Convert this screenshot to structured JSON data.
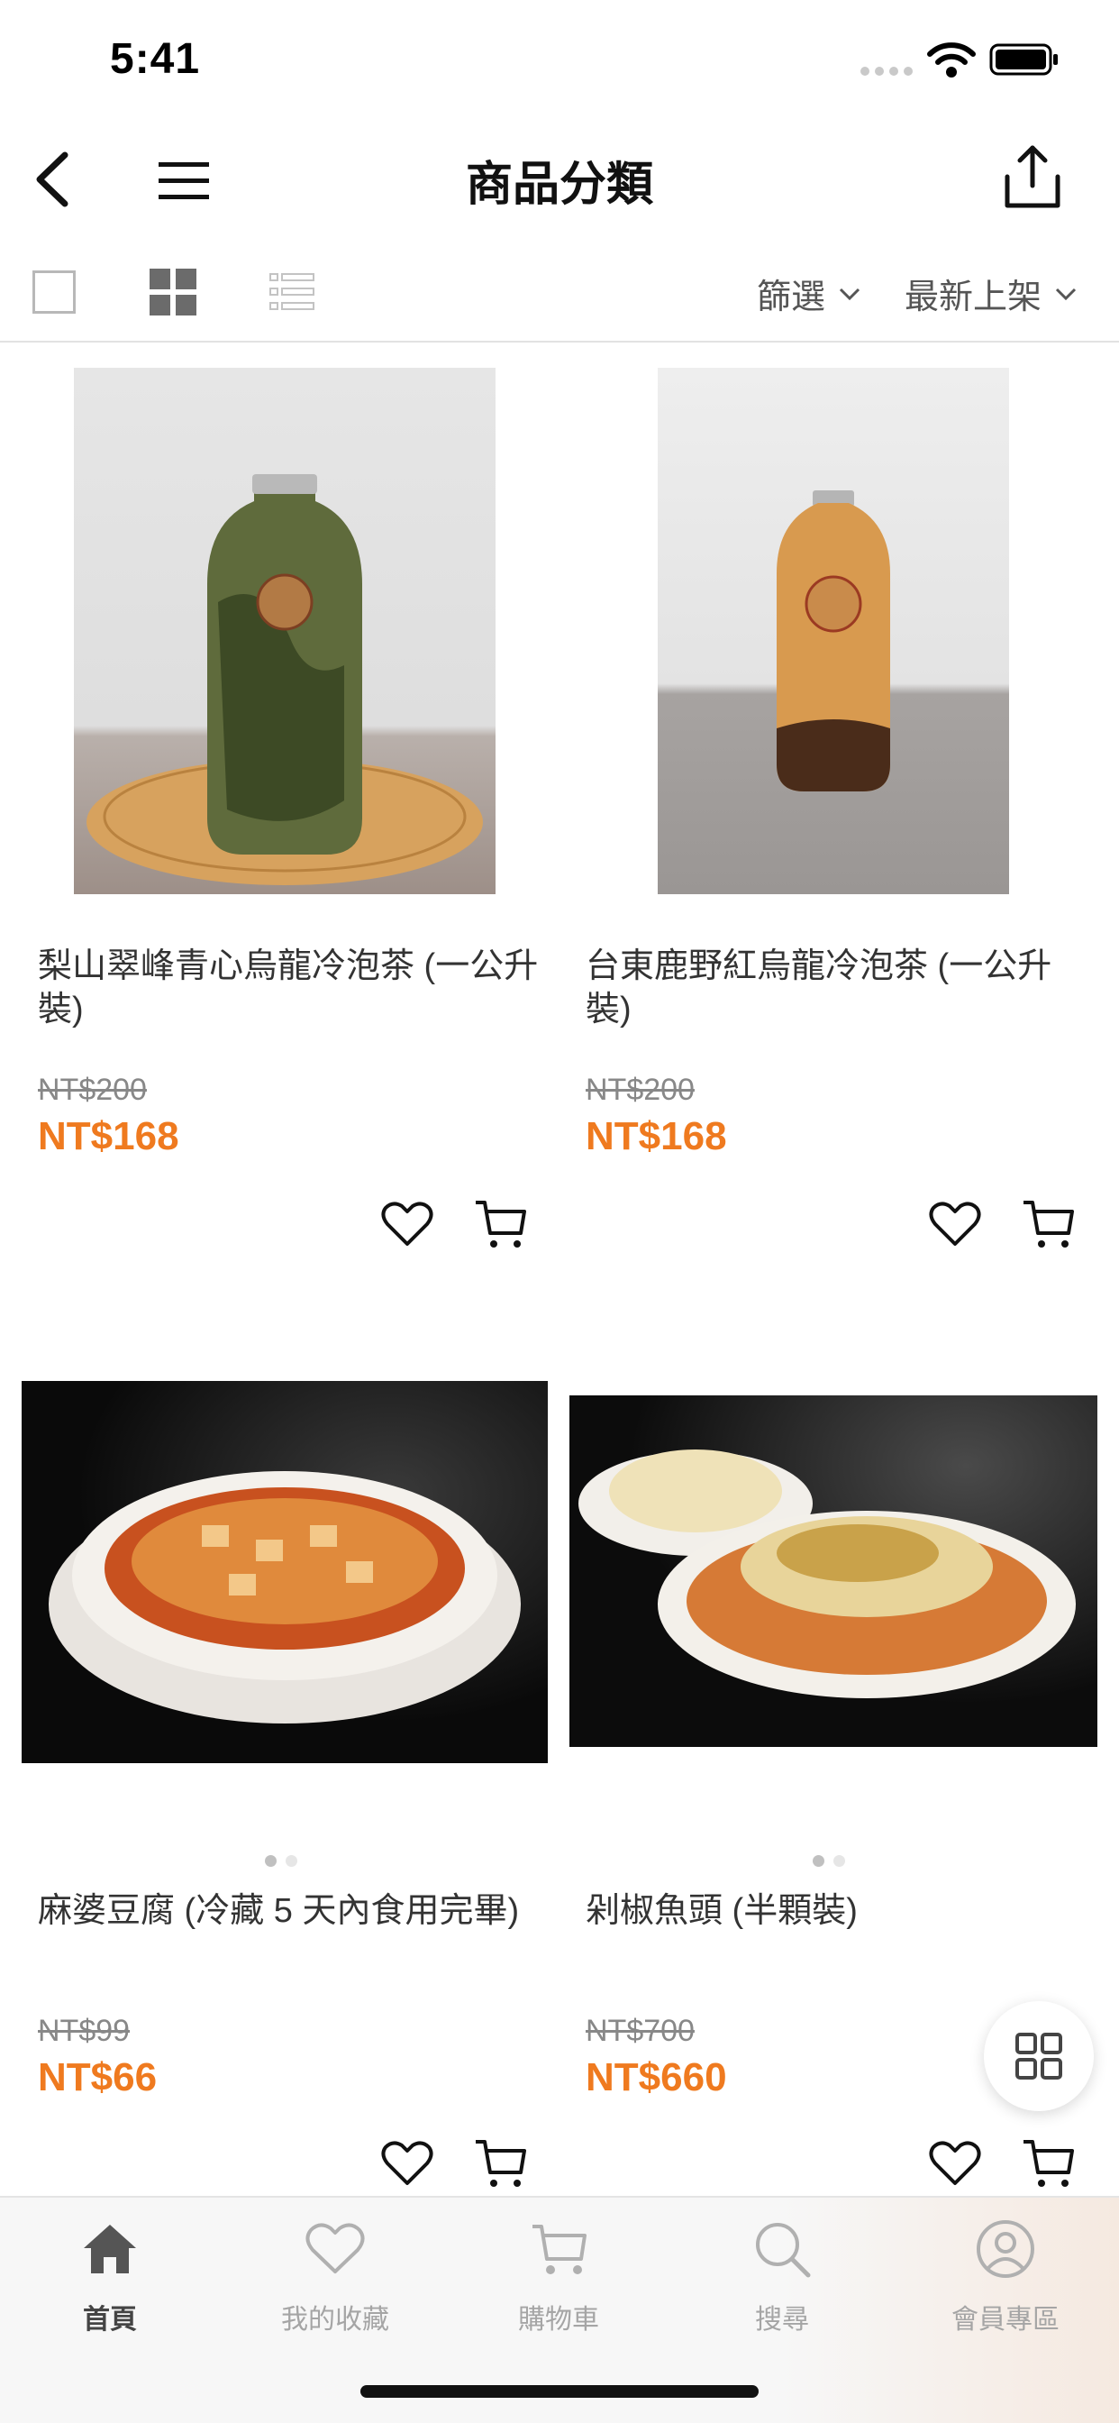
{
  "status_bar": {
    "time": "5:41"
  },
  "navbar": {
    "title": "商品分類"
  },
  "toolbar": {
    "filter_label": "篩選",
    "sort_label": "最新上架"
  },
  "products": [
    {
      "name": "梨山翠峰青心烏龍冷泡茶 (一公升裝)",
      "old_price": "NT$200",
      "price": "NT$168",
      "photo": "green-tea-bottle"
    },
    {
      "name": "台東鹿野紅烏龍冷泡茶 (一公升裝)",
      "old_price": "NT$200",
      "price": "NT$168",
      "photo": "amber-tea-bottle"
    },
    {
      "name": "麻婆豆腐 (冷藏 5 天內食用完畢)",
      "old_price": "NT$99",
      "price": "NT$66",
      "photo": "mapo-tofu"
    },
    {
      "name": "剁椒魚頭 (半顆裝)",
      "old_price": "NT$700",
      "price": "NT$660",
      "photo": "chili-fish-head"
    }
  ],
  "tabbar": {
    "items": [
      {
        "label": "首頁",
        "icon": "home-icon",
        "active": true
      },
      {
        "label": "我的收藏",
        "icon": "heart-icon",
        "active": false
      },
      {
        "label": "購物車",
        "icon": "cart-icon",
        "active": false
      },
      {
        "label": "搜尋",
        "icon": "search-icon",
        "active": false
      },
      {
        "label": "會員專區",
        "icon": "user-icon",
        "active": false
      }
    ]
  },
  "colors": {
    "price": "#ef7a1f",
    "text": "#333333",
    "muted": "#a5a5a5"
  }
}
